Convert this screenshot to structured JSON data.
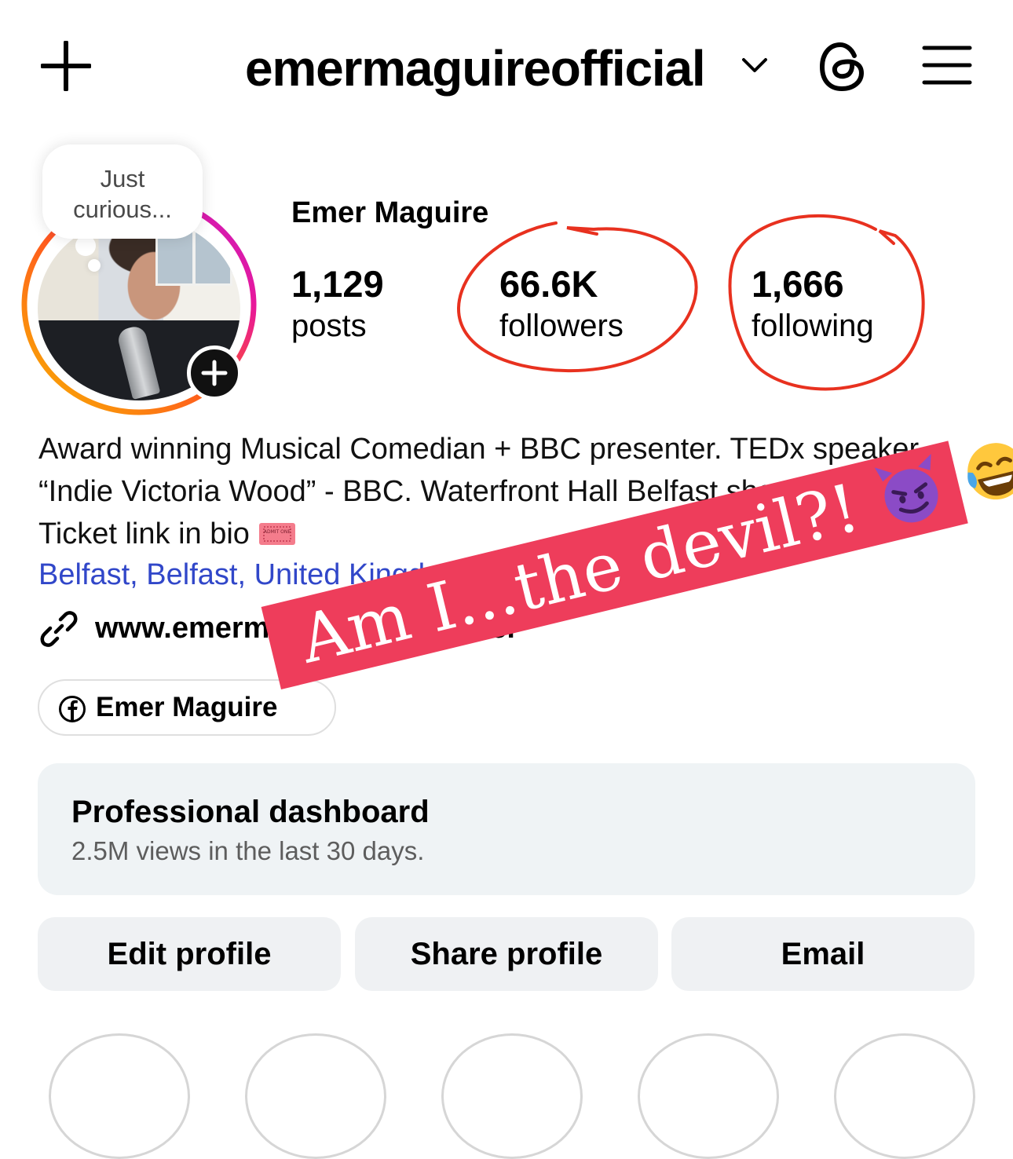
{
  "topbar": {
    "username": "emermaguireofficial",
    "icons": [
      "plus-icon",
      "chevron-down-icon",
      "threads-icon",
      "menu-icon"
    ]
  },
  "note": {
    "text_line1": "Just",
    "text_line2": "curious..."
  },
  "profile": {
    "display_name": "Emer Maguire",
    "posts_count": "1,129",
    "posts_label": "posts",
    "followers_count": "66.6K",
    "followers_label": "followers",
    "following_count": "1,666",
    "following_label": "following"
  },
  "bio": {
    "text": "Award winning Musical Comedian + BBC presenter. TEDx speaker. “Indie Victoria Wood” - BBC. Waterfront Hall Belfast show OUT NOW. Ticket link in bio",
    "ticket_emoji_text": "ADMIT ONE",
    "location": "Belfast, Belfast, United Kingdom",
    "link": "www.emermaguire.com/gener",
    "facebook_label": "Emer Maguire"
  },
  "sticker": {
    "text": "Am I...the devil?!",
    "color": "#ee3d5b"
  },
  "dashboard": {
    "title": "Professional dashboard",
    "subtitle": "2.5M views in the last 30 days."
  },
  "actions": {
    "edit": "Edit profile",
    "share": "Share profile",
    "email": "Email"
  },
  "colors": {
    "link": "#3147c9",
    "scribble": "#e8311f",
    "button_bg": "#eff1f3",
    "dashboard_bg": "#eff3f5"
  }
}
